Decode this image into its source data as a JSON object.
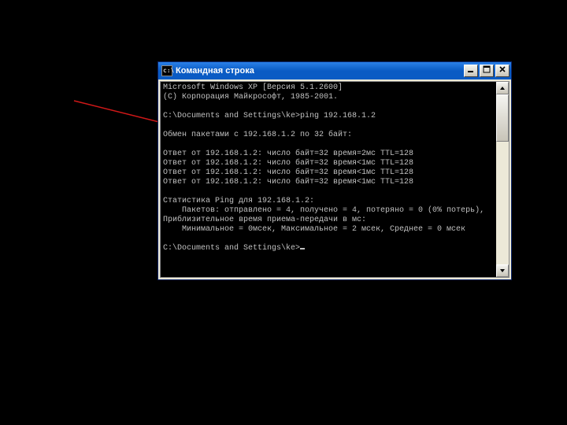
{
  "window": {
    "title": "Командная строка",
    "sys_icon_label": "cmd"
  },
  "console": {
    "lines": [
      "Microsoft Windows XP [Версия 5.1.2600]",
      "(С) Корпорация Майкрософт, 1985-2001.",
      "",
      "C:\\Documents and Settings\\ke>ping 192.168.1.2",
      "",
      "Обмен пакетами с 192.168.1.2 по 32 байт:",
      "",
      "Ответ от 192.168.1.2: число байт=32 время=2мс TTL=128",
      "Ответ от 192.168.1.2: число байт=32 время<1мс TTL=128",
      "Ответ от 192.168.1.2: число байт=32 время<1мс TTL=128",
      "Ответ от 192.168.1.2: число байт=32 время<1мс TTL=128",
      "",
      "Статистика Ping для 192.168.1.2:",
      "    Пакетов: отправлено = 4, получено = 4, потеряно = 0 (0% потерь),",
      "Приблизительное время приема-передачи в мс:",
      "    Минимальное = 0мсек, Максимальное = 2 мсек, Среднее = 0 мсек",
      "",
      "C:\\Documents and Settings\\ke>_"
    ]
  },
  "annotation": {
    "arrow_color": "#d01818"
  }
}
